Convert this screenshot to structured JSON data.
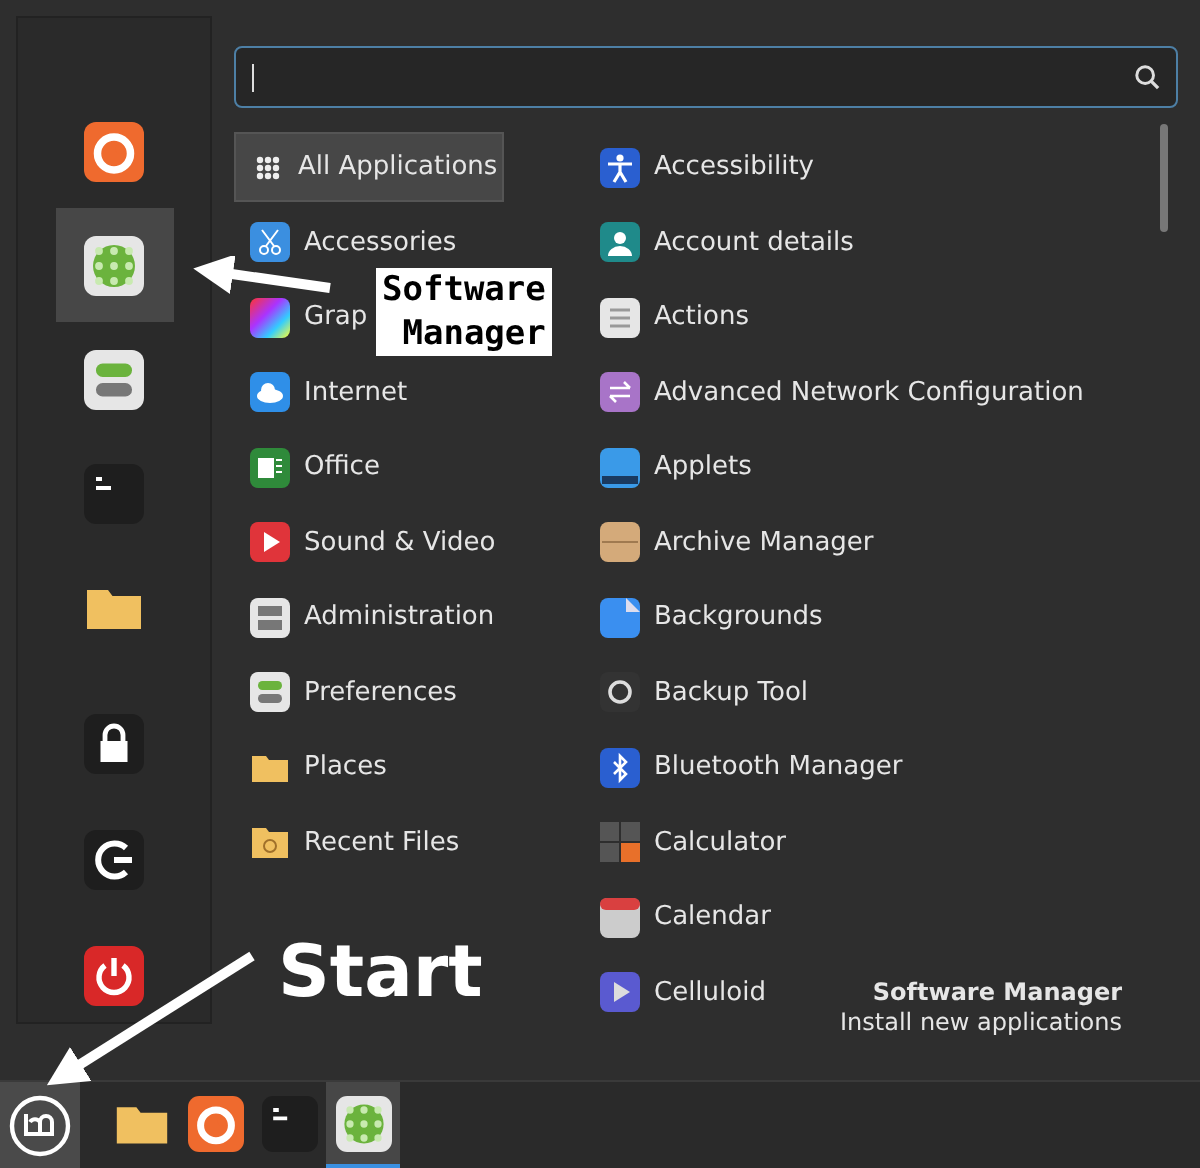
{
  "favorites": [
    {
      "selected": false
    },
    {
      "selected": true
    },
    {
      "selected": false
    },
    {
      "selected": false
    },
    {
      "selected": false
    }
  ],
  "categories": [
    {
      "label": "All Applications",
      "selected": true
    },
    {
      "label": "Accessories",
      "selected": false
    },
    {
      "label": "Grap",
      "selected": false
    },
    {
      "label": "Internet",
      "selected": false
    },
    {
      "label": "Office",
      "selected": false
    },
    {
      "label": "Sound & Video",
      "selected": false
    },
    {
      "label": "Administration",
      "selected": false
    },
    {
      "label": "Preferences",
      "selected": false
    },
    {
      "label": "Places",
      "selected": false
    },
    {
      "label": "Recent Files",
      "selected": false
    }
  ],
  "applications": [
    "Accessibility",
    "Account details",
    "Actions",
    "Advanced Network Configuration",
    "Applets",
    "Archive Manager",
    "Backgrounds",
    "Backup Tool",
    "Bluetooth Manager",
    "Calculator",
    "Calendar",
    "Celluloid"
  ],
  "description": {
    "title": "Software Manager",
    "subtitle": "Install new applications"
  },
  "taskbar": [
    {
      "selected": false
    },
    {
      "selected": false
    },
    {
      "selected": false
    },
    {
      "selected": true
    }
  ],
  "annotations": [
    {
      "kind": "box",
      "text": "Software\nManager"
    },
    {
      "kind": "plain",
      "text": "Start"
    }
  ]
}
